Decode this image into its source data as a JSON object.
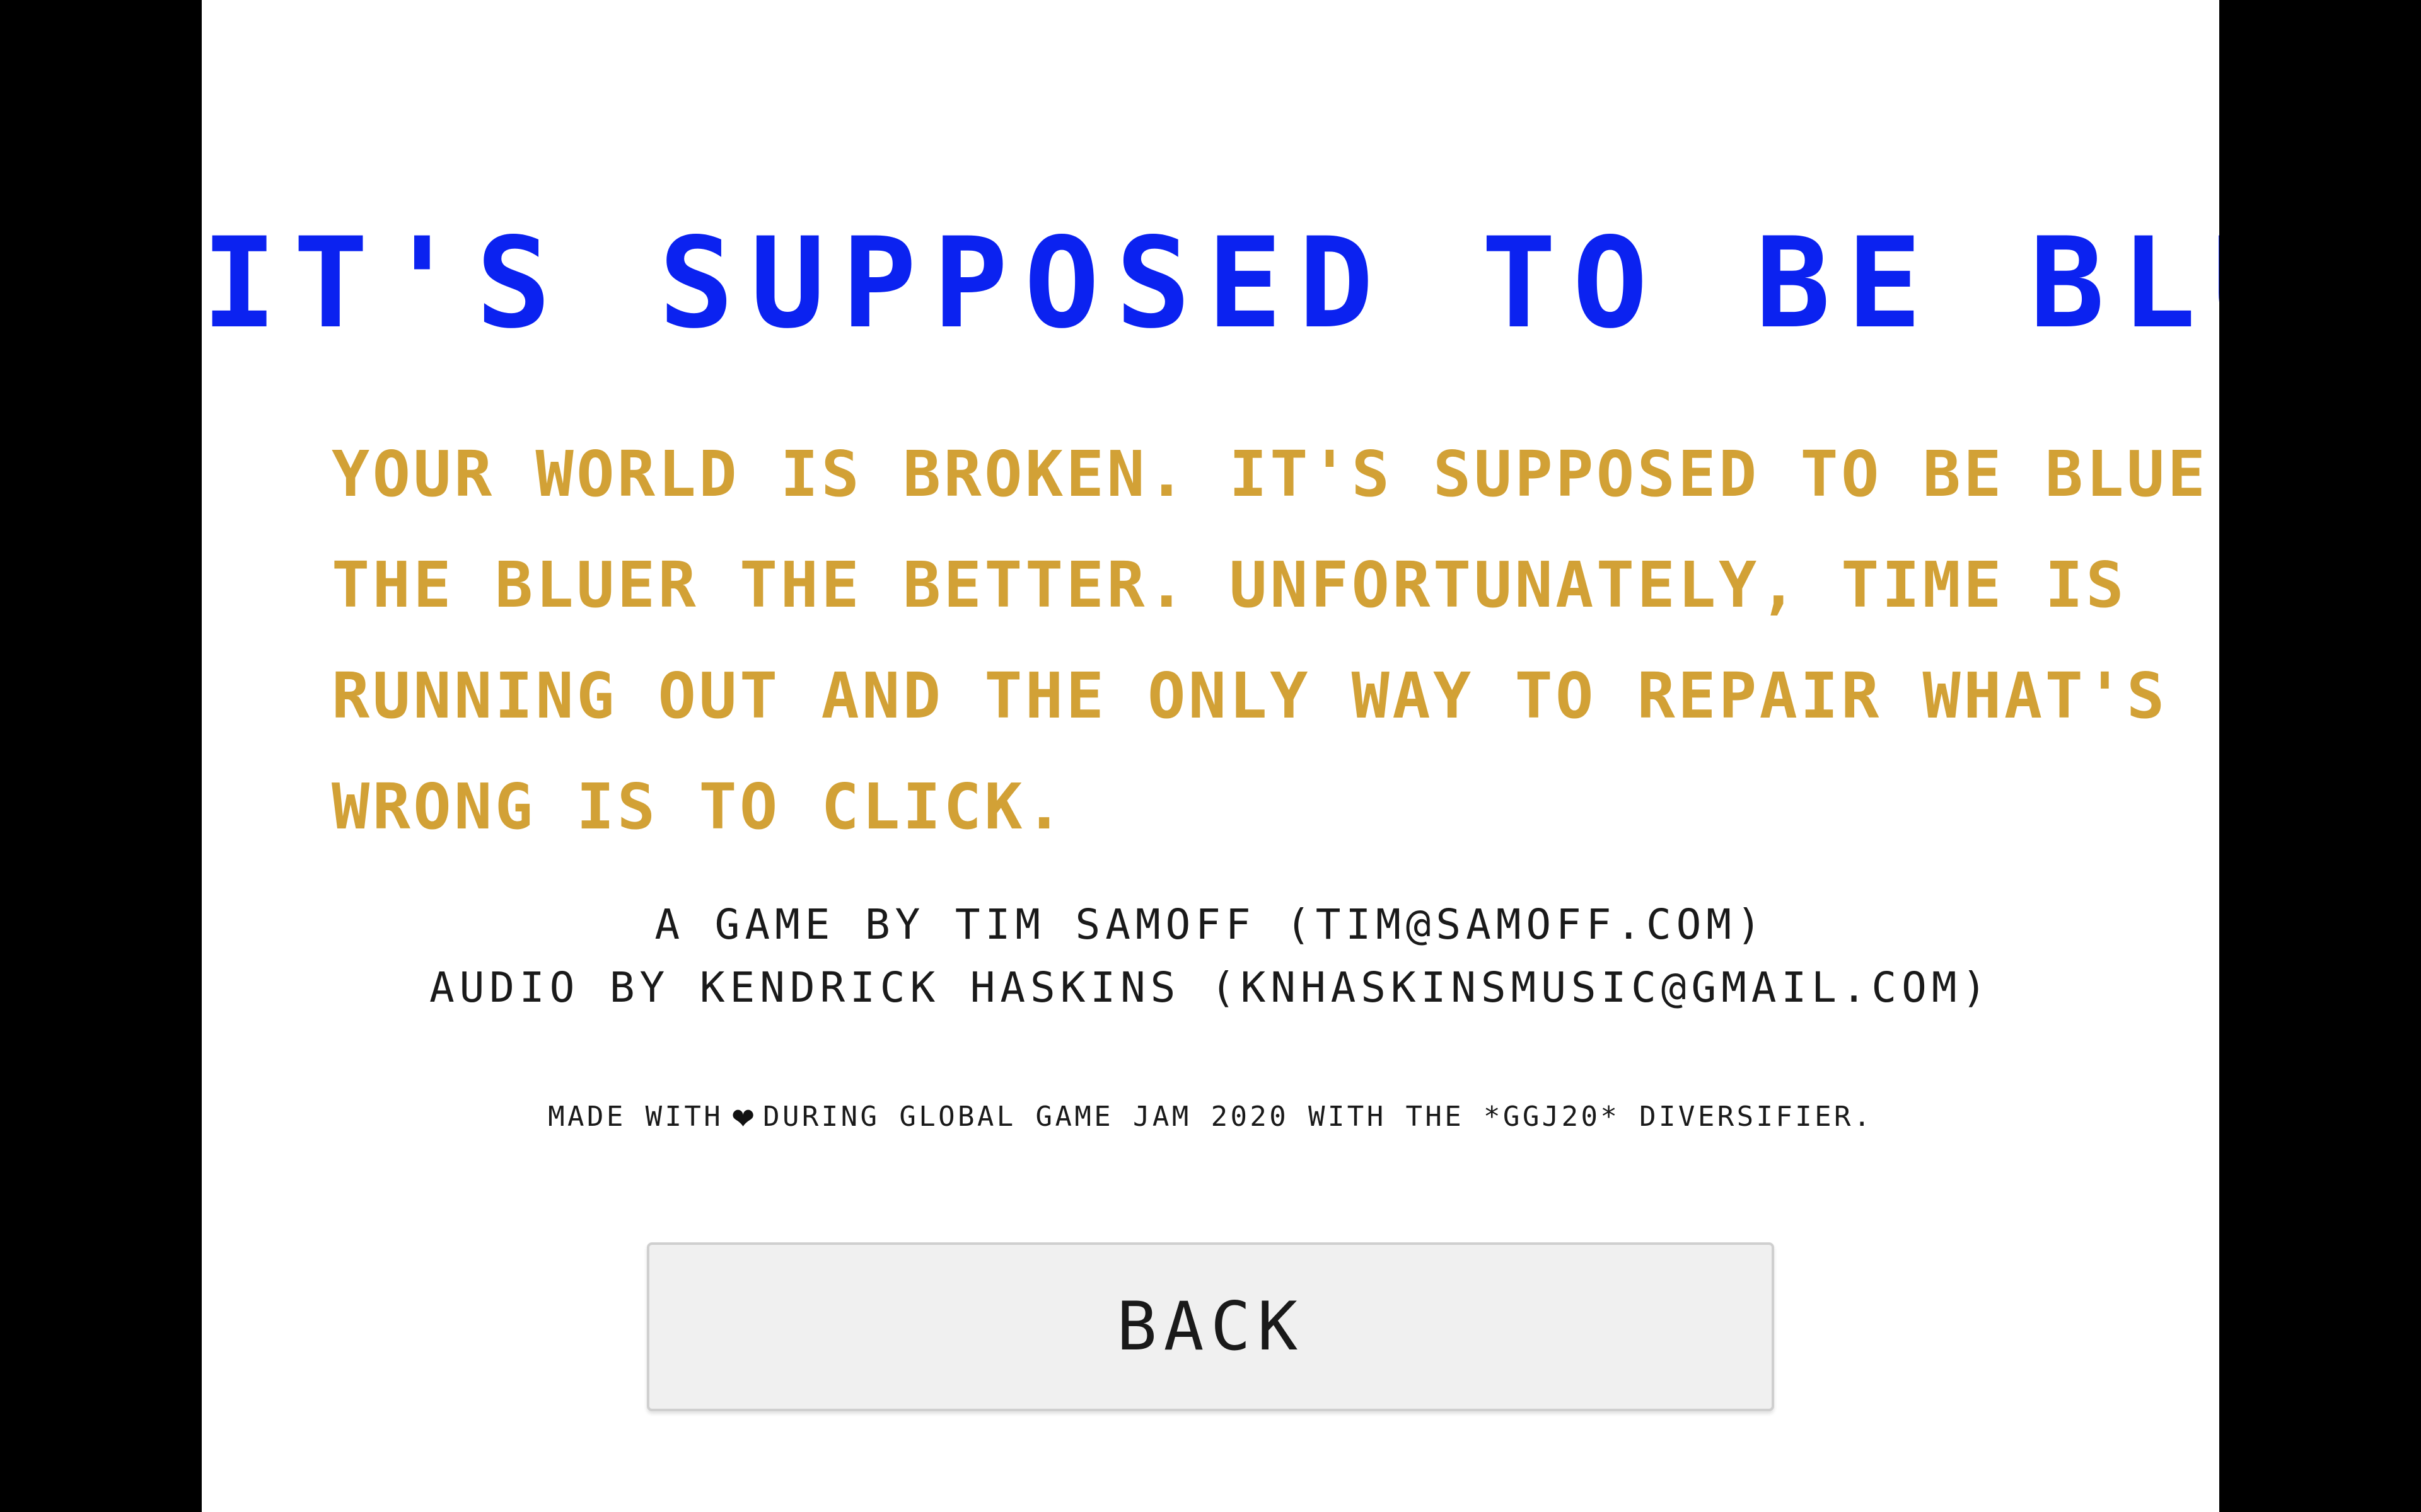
{
  "game": {
    "title": "IT'S SUPPOSED TO BE BLUE",
    "story": {
      "line1": "YOUR WORLD IS BROKEN. IT'S SUPPOSED TO BE BLUE -",
      "line2": "THE BLUER THE BETTER. UNFORTUNATELY, TIME IS",
      "line3": "RUNNING OUT AND THE ONLY WAY TO REPAIR WHAT'S",
      "line4": "WRONG IS TO CLICK."
    },
    "credits": {
      "game_by": "A GAME BY TIM SAMOFF (TIM@SAMOFF.COM)",
      "audio_by": "AUDIO BY KENDRICK HASKINS (KNHASKINSMUSIC@GMAIL.COM)"
    },
    "jam_note": {
      "before_heart": "MADE WITH",
      "heart_glyph": "❤",
      "after_heart": "DURING GLOBAL GAME JAM 2020 WITH THE *GGJ20* DIVERSIFIER."
    },
    "back_button": {
      "label": "BACK"
    }
  },
  "colors": {
    "letterbox": "#000000",
    "canvas_background": "#ffffff",
    "title": "#0b22f0",
    "story_text": "#d2a136",
    "credits_text": "#1a1a1a",
    "button_background": "#f0f0f0",
    "button_border": "#cfcfcf"
  },
  "icons": {
    "heart": "heart-icon"
  }
}
